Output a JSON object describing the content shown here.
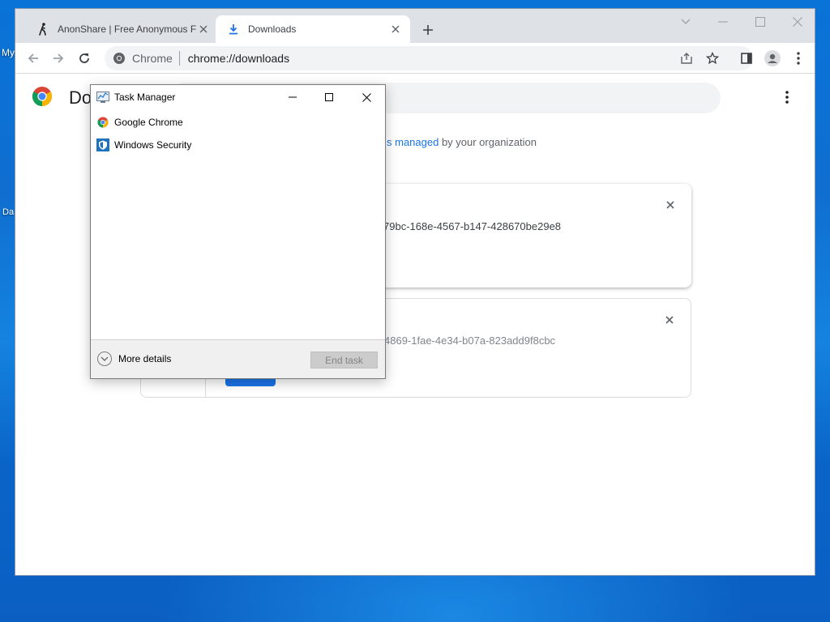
{
  "desktop": {
    "labels": [
      "My",
      "Da"
    ]
  },
  "browser": {
    "tabs": [
      {
        "title": "AnonShare | Free Anonymous Fil",
        "active": false,
        "favicon": "walking-person-icon"
      },
      {
        "title": "Downloads",
        "active": true,
        "favicon": "download-icon"
      }
    ],
    "omnibox": {
      "chip": "Chrome",
      "url": "chrome://downloads"
    }
  },
  "downloads_page": {
    "title": "Do",
    "managed_notice": {
      "link": "s managed",
      "rest": " by your organization"
    },
    "items": [
      {
        "file": "79bc-168e-4567-b147-428670be29e8"
      },
      {
        "file": "4869-1fae-4e34-b07a-823add9f8cbc"
      }
    ]
  },
  "task_manager": {
    "title": "Task Manager",
    "processes": [
      {
        "name": "Google Chrome",
        "icon": "chrome-icon"
      },
      {
        "name": "Windows Security",
        "icon": "windows-security-icon"
      }
    ],
    "more_details": "More details",
    "end_task": "End task"
  },
  "colors": {
    "accent": "#1a73e8",
    "desktop": "#0a6fd4"
  }
}
